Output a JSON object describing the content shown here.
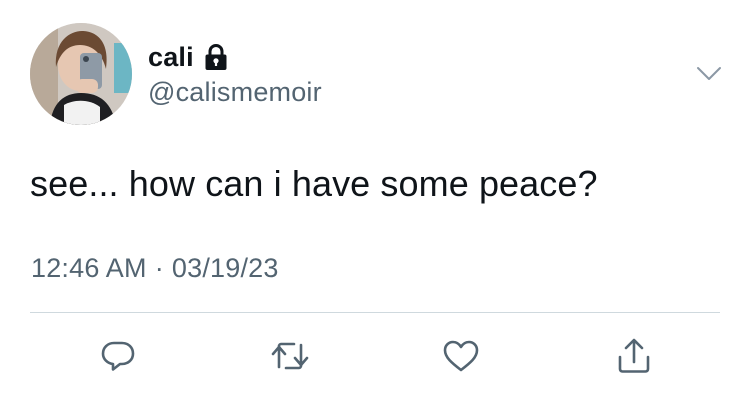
{
  "author": {
    "display_name": "cali",
    "handle": "@calismemoir",
    "protected_icon": "lock-icon"
  },
  "tweet": {
    "text": "see... how can i have some peace?",
    "time": "12:46 AM",
    "separator": "·",
    "date": "03/19/23"
  },
  "menu": {
    "icon": "chevron-down-icon"
  },
  "actions": [
    {
      "name": "reply",
      "icon": "reply-icon"
    },
    {
      "name": "retweet",
      "icon": "retweet-icon"
    },
    {
      "name": "like",
      "icon": "heart-icon"
    },
    {
      "name": "share",
      "icon": "share-icon"
    }
  ],
  "colors": {
    "text_primary": "#0f1419",
    "text_secondary": "#536471",
    "divider": "#cfd9de",
    "icon": "#536471"
  }
}
